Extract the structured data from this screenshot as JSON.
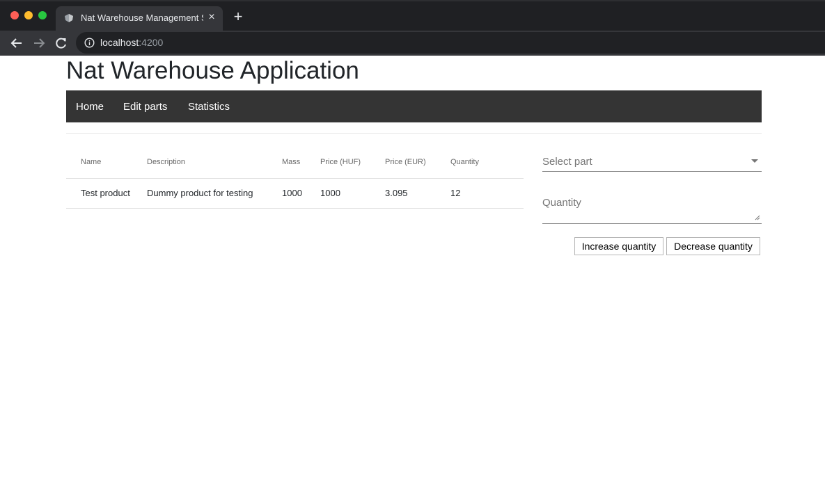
{
  "browser": {
    "tab_title": "Nat Warehouse Management S",
    "url_host": "localhost",
    "url_port": ":4200"
  },
  "app": {
    "title": "Nat Warehouse Application",
    "nav": [
      "Home",
      "Edit parts",
      "Statistics"
    ]
  },
  "table": {
    "headers": [
      "Name",
      "Description",
      "Mass",
      "Price (HUF)",
      "Price (EUR)",
      "Quantity"
    ],
    "rows": [
      [
        "Test product",
        "Dummy product for testing",
        "1000",
        "1000",
        "3.095",
        "12"
      ]
    ]
  },
  "form": {
    "select_placeholder": "Select part",
    "quantity_placeholder": "Quantity",
    "increase_label": "Increase quantity",
    "decrease_label": "Decrease quantity"
  },
  "colors": {
    "navbar": "#343434",
    "browser_frame": "#1f2023",
    "toolbar": "#35363a"
  }
}
